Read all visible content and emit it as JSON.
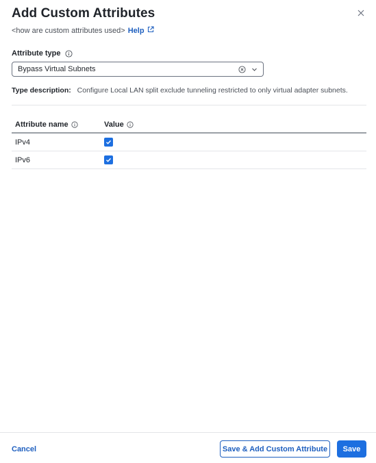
{
  "dialog": {
    "title": "Add Custom Attributes",
    "subtitle": "<how are custom attributes used>",
    "help_label": "Help"
  },
  "attribute_type": {
    "label": "Attribute type",
    "selected_value": "Bypass Virtual Subnets"
  },
  "type_description": {
    "label": "Type description:",
    "text": "Configure Local LAN split exclude tunneling restricted to only virtual adapter subnets."
  },
  "table": {
    "columns": [
      "Attribute name",
      "Value"
    ],
    "rows": [
      {
        "name": "IPv4",
        "checked": true
      },
      {
        "name": "IPv6",
        "checked": true
      }
    ]
  },
  "footer": {
    "cancel_label": "Cancel",
    "save_add_label": "Save & Add Custom Attribute",
    "save_label": "Save"
  },
  "colors": {
    "accent": "#1d6fe0",
    "link": "#1e5fbf"
  }
}
